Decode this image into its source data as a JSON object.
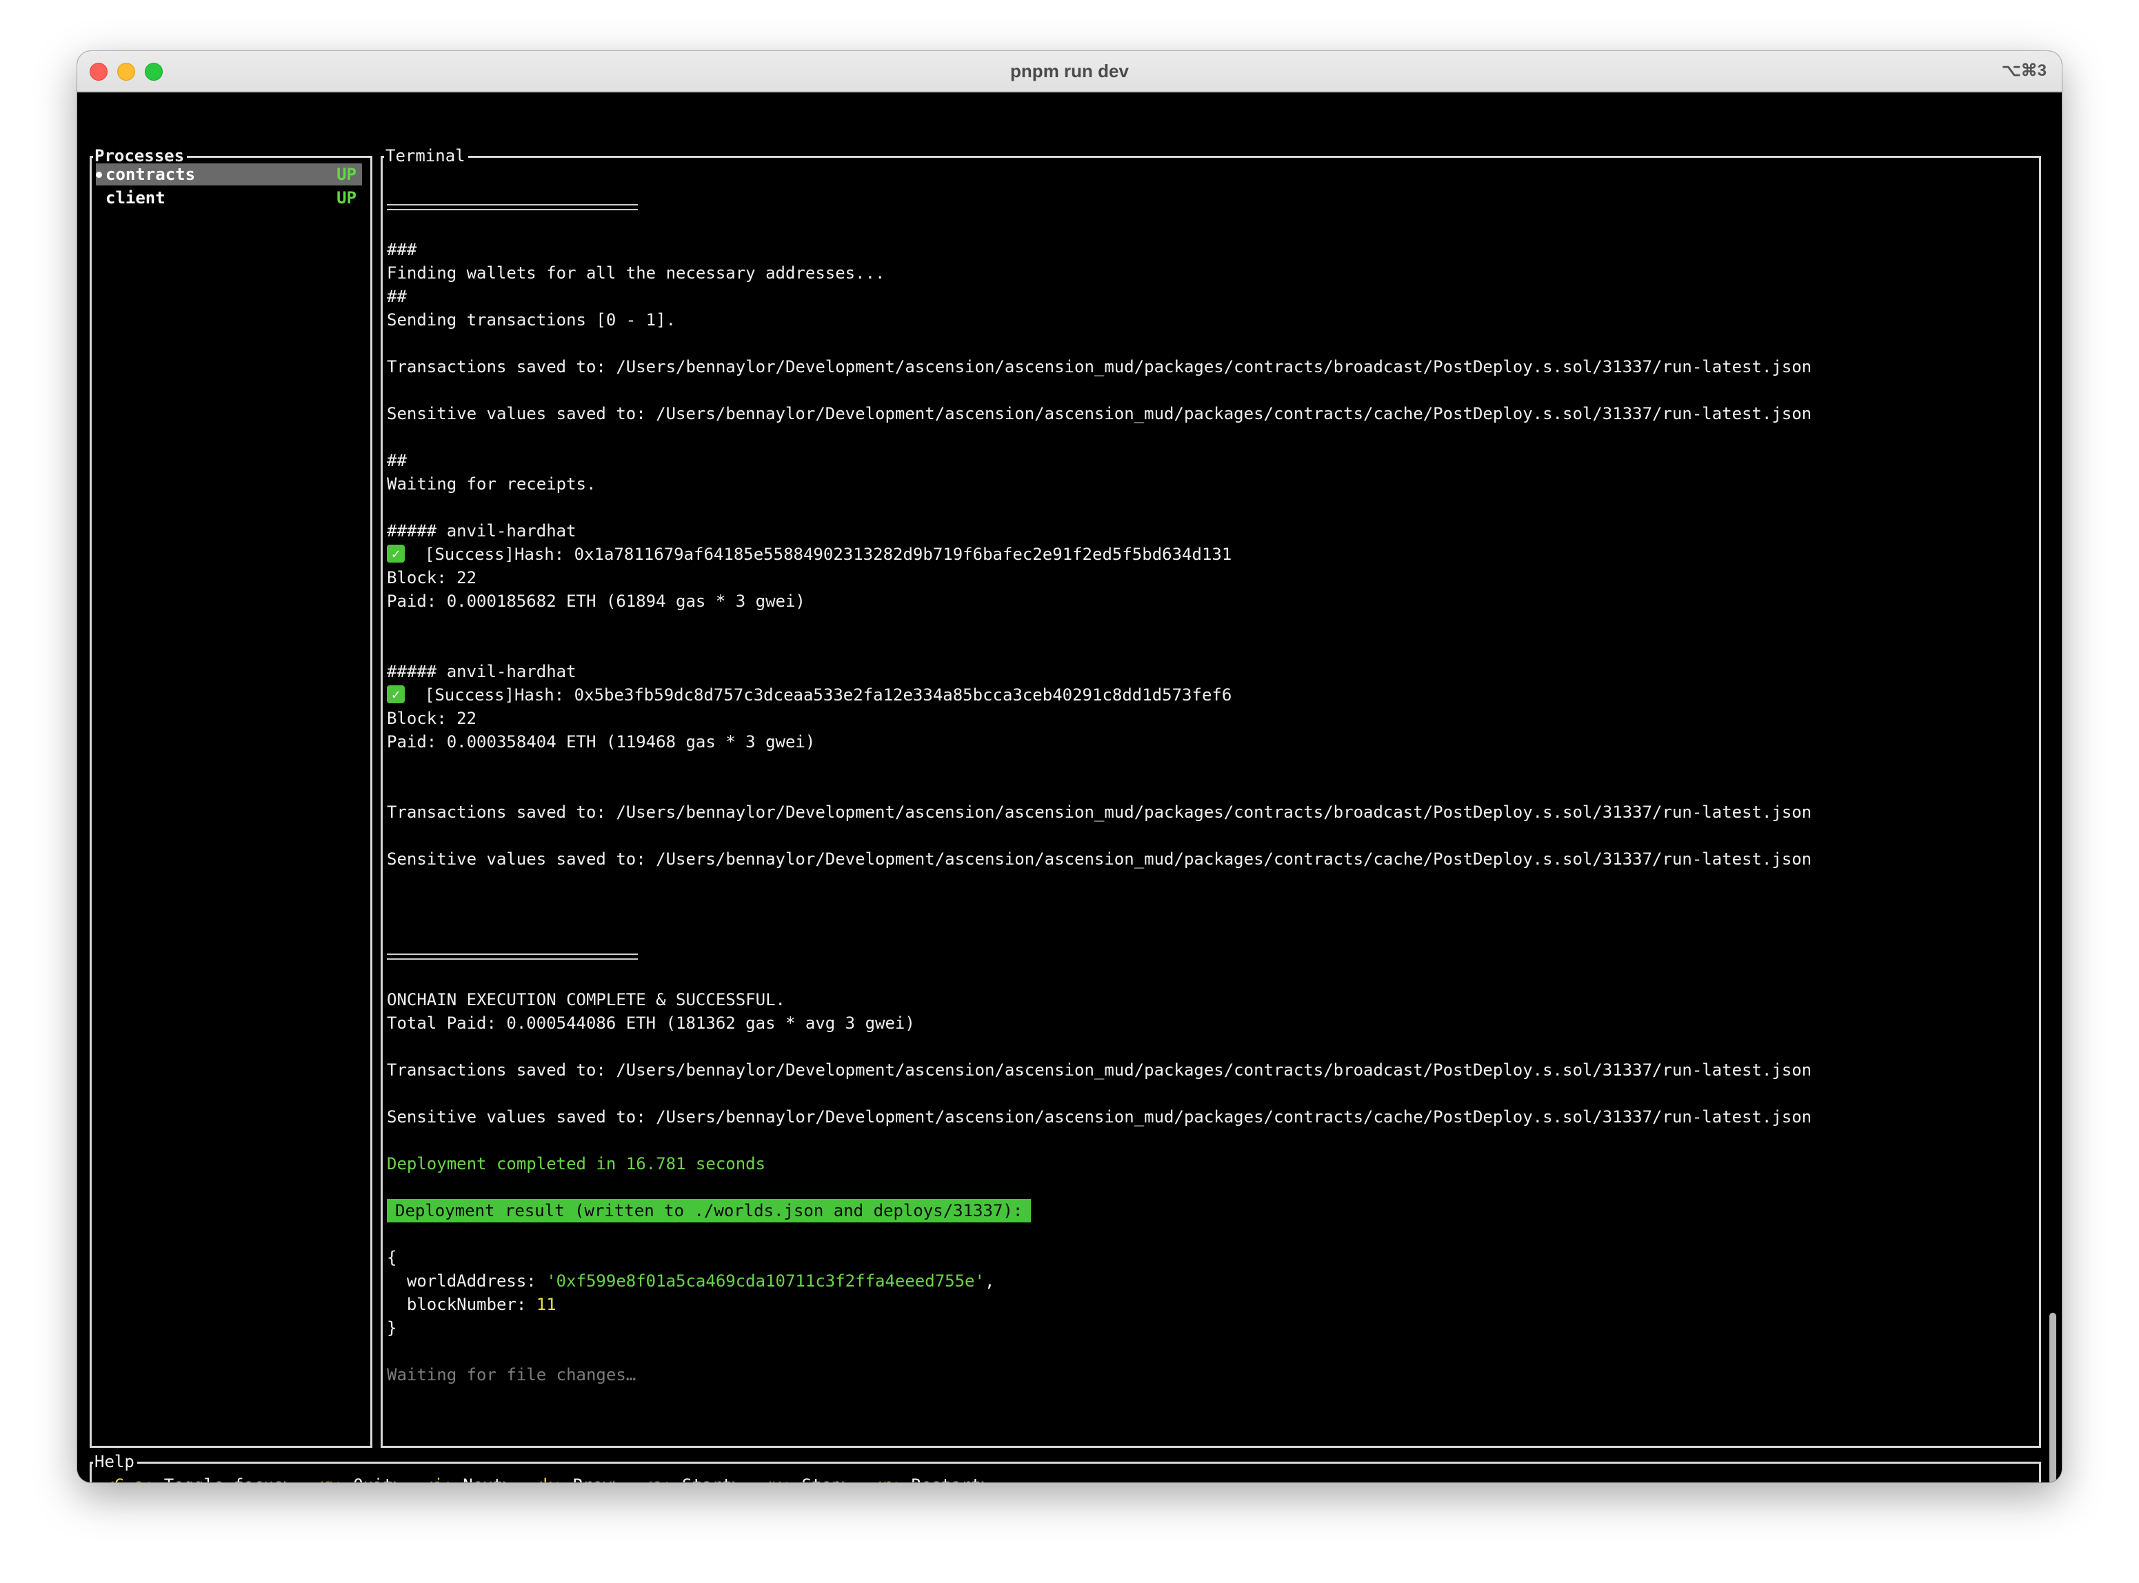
{
  "window": {
    "title": "pnpm run dev",
    "shortcut": "⌥⌘3"
  },
  "processes": {
    "label": "Processes",
    "items": [
      {
        "name": "contracts",
        "status": "UP",
        "selected": true
      },
      {
        "name": "client",
        "status": "UP",
        "selected": false
      }
    ]
  },
  "terminal": {
    "label": "Terminal",
    "lines": {
      "l1": "###",
      "l2": "Finding wallets for all the necessary addresses...",
      "l3": "##",
      "l4": "Sending transactions [0 - 1].",
      "l5": "Transactions saved to: /Users/bennaylor/Development/ascension/ascension_mud/packages/contracts/broadcast/PostDeploy.s.sol/31337/run-latest.json",
      "l6": "Sensitive values saved to: /Users/bennaylor/Development/ascension/ascension_mud/packages/contracts/cache/PostDeploy.s.sol/31337/run-latest.json",
      "l7": "##",
      "l8": "Waiting for receipts.",
      "tx1_header": "##### anvil-hardhat",
      "tx1_hash": "[Success]Hash: 0x1a7811679af64185e55884902313282d9b719f6bafec2e91f2ed5f5bd634d131",
      "tx1_block": "Block: 22",
      "tx1_paid": "Paid: 0.000185682 ETH (61894 gas * 3 gwei)",
      "tx2_header": "##### anvil-hardhat",
      "tx2_hash": "[Success]Hash: 0x5be3fb59dc8d757c3dceaa533e2fa12e334a85bcca3ceb40291c8dd1d573fef6",
      "tx2_block": "Block: 22",
      "tx2_paid": "Paid: 0.000358404 ETH (119468 gas * 3 gwei)",
      "l9": "Transactions saved to: /Users/bennaylor/Development/ascension/ascension_mud/packages/contracts/broadcast/PostDeploy.s.sol/31337/run-latest.json",
      "l10": "Sensitive values saved to: /Users/bennaylor/Development/ascension/ascension_mud/packages/contracts/cache/PostDeploy.s.sol/31337/run-latest.json",
      "l11": "ONCHAIN EXECUTION COMPLETE & SUCCESSFUL.",
      "l12": "Total Paid: 0.000544086 ETH (181362 gas * avg 3 gwei)",
      "l13": "Transactions saved to: /Users/bennaylor/Development/ascension/ascension_mud/packages/contracts/broadcast/PostDeploy.s.sol/31337/run-latest.json",
      "l14": "Sensitive values saved to: /Users/bennaylor/Development/ascension/ascension_mud/packages/contracts/cache/PostDeploy.s.sol/31337/run-latest.json",
      "deploy_time": "Deployment completed in 16.781 seconds",
      "result_banner": "Deployment result (written to ./worlds.json and deploys/31337):",
      "brace_open": "{",
      "world_key": "  worldAddress: ",
      "world_val": "'0xf599e8f01a5ca469cda10711c3f2ffa4eeed755e'",
      "world_comma": ",",
      "block_key": "  blockNumber: ",
      "block_val": "11",
      "brace_close": "}",
      "waiting": "Waiting for file changes…"
    },
    "check_icon": "✓"
  },
  "help": {
    "label": "Help",
    "items": [
      {
        "key": "<C-a:",
        "action": " Toggle focus>"
      },
      {
        "key": "<q:",
        "action": " Quit>"
      },
      {
        "key": "<j:",
        "action": " Next>"
      },
      {
        "key": "<k:",
        "action": " Prev>"
      },
      {
        "key": "<s:",
        "action": " Start>"
      },
      {
        "key": "<x:",
        "action": " Stop>"
      },
      {
        "key": "<r:",
        "action": " Restart>"
      }
    ]
  },
  "colors": {
    "accent_green": "#47c53a",
    "status_green": "#62d844",
    "key_yellow": "#e6d24a"
  }
}
